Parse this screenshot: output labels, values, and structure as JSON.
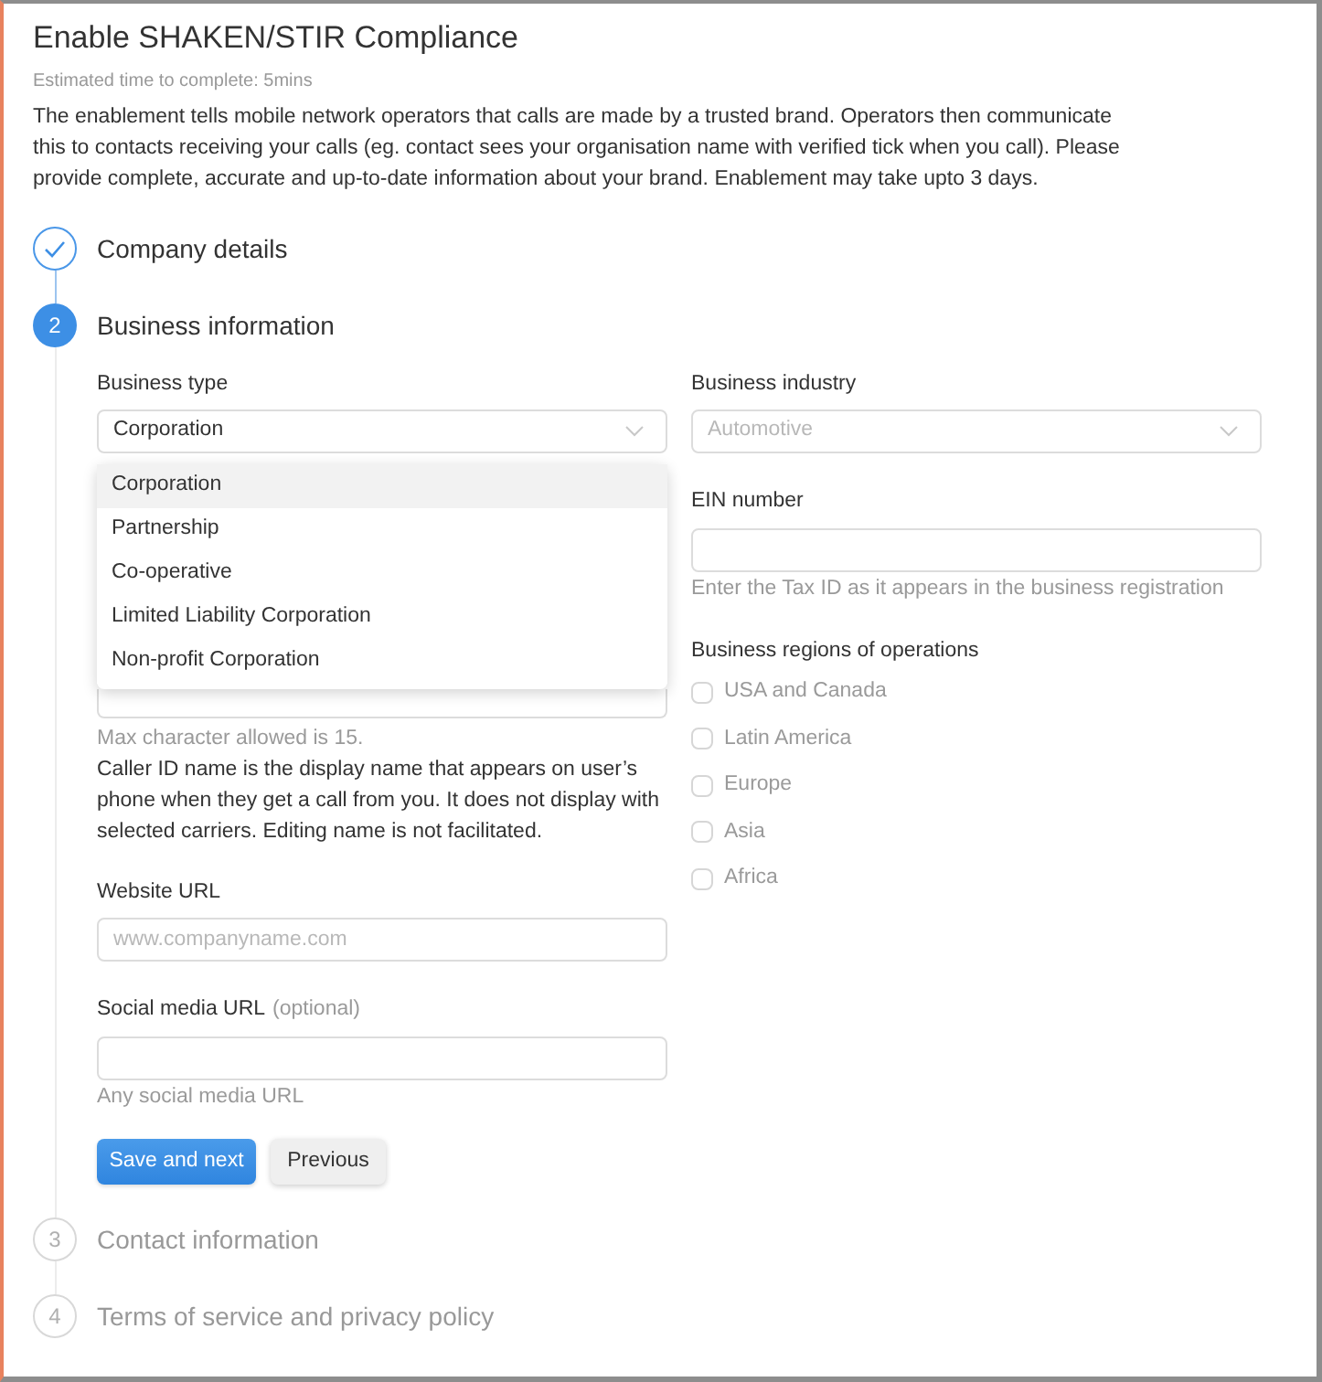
{
  "header": {
    "title": "Enable SHAKEN/STIR Compliance",
    "estimate": "Estimated time to complete: 5mins",
    "description": "The enablement tells mobile network operators that calls are made by a trusted brand. Operators then communicate this to contacts receiving your calls (eg. contact sees your organisation name with verified tick when you call). Please provide complete, accurate and up-to-date information about your brand. Enablement may take upto 3 days."
  },
  "steps": [
    {
      "label": "Company details",
      "completed": true,
      "active": false
    },
    {
      "number": "2",
      "label": "Business information",
      "completed": false,
      "active": true
    },
    {
      "number": "3",
      "label": "Contact information",
      "completed": false,
      "active": false
    },
    {
      "number": "4",
      "label": "Terms of service and privacy policy",
      "completed": false,
      "active": false
    }
  ],
  "business_information": {
    "business_type": {
      "label": "Business type",
      "value": "Corporation",
      "expanded": true,
      "options": [
        {
          "label": "Corporation",
          "selected": true
        },
        {
          "label": "Partnership",
          "selected": false
        },
        {
          "label": "Co-operative",
          "selected": false
        },
        {
          "label": "Limited Liability Corporation",
          "selected": false
        },
        {
          "label": "Non-profit Corporation",
          "selected": false
        }
      ]
    },
    "caller_id": {
      "hint": "Max character allowed is 15.",
      "description": "Caller ID name is the display name that appears on user’s phone when they get a call from you. It does not display with selected carriers. Editing name is not facilitated."
    },
    "website_url": {
      "label": "Website URL",
      "placeholder": "www.companyname.com"
    },
    "social_media_url": {
      "label": "Social media URL",
      "optional": "(optional)",
      "hint": "Any social media URL"
    },
    "buttons": [
      {
        "label": "Save and next",
        "kind": "primary"
      },
      {
        "label": "Previous",
        "kind": "secondary"
      }
    ],
    "business_industry": {
      "label": "Business industry",
      "placeholder": "Automotive"
    },
    "ein_number": {
      "label": "EIN number",
      "hint": "Enter the Tax ID as it appears in the business registration"
    },
    "regions": {
      "label": "Business regions of operations",
      "options": [
        {
          "label": "USA and Canada",
          "checked": false
        },
        {
          "label": "Latin America",
          "checked": false
        },
        {
          "label": "Europe",
          "checked": false
        },
        {
          "label": "Asia",
          "checked": false
        },
        {
          "label": "Africa",
          "checked": false
        }
      ]
    }
  }
}
